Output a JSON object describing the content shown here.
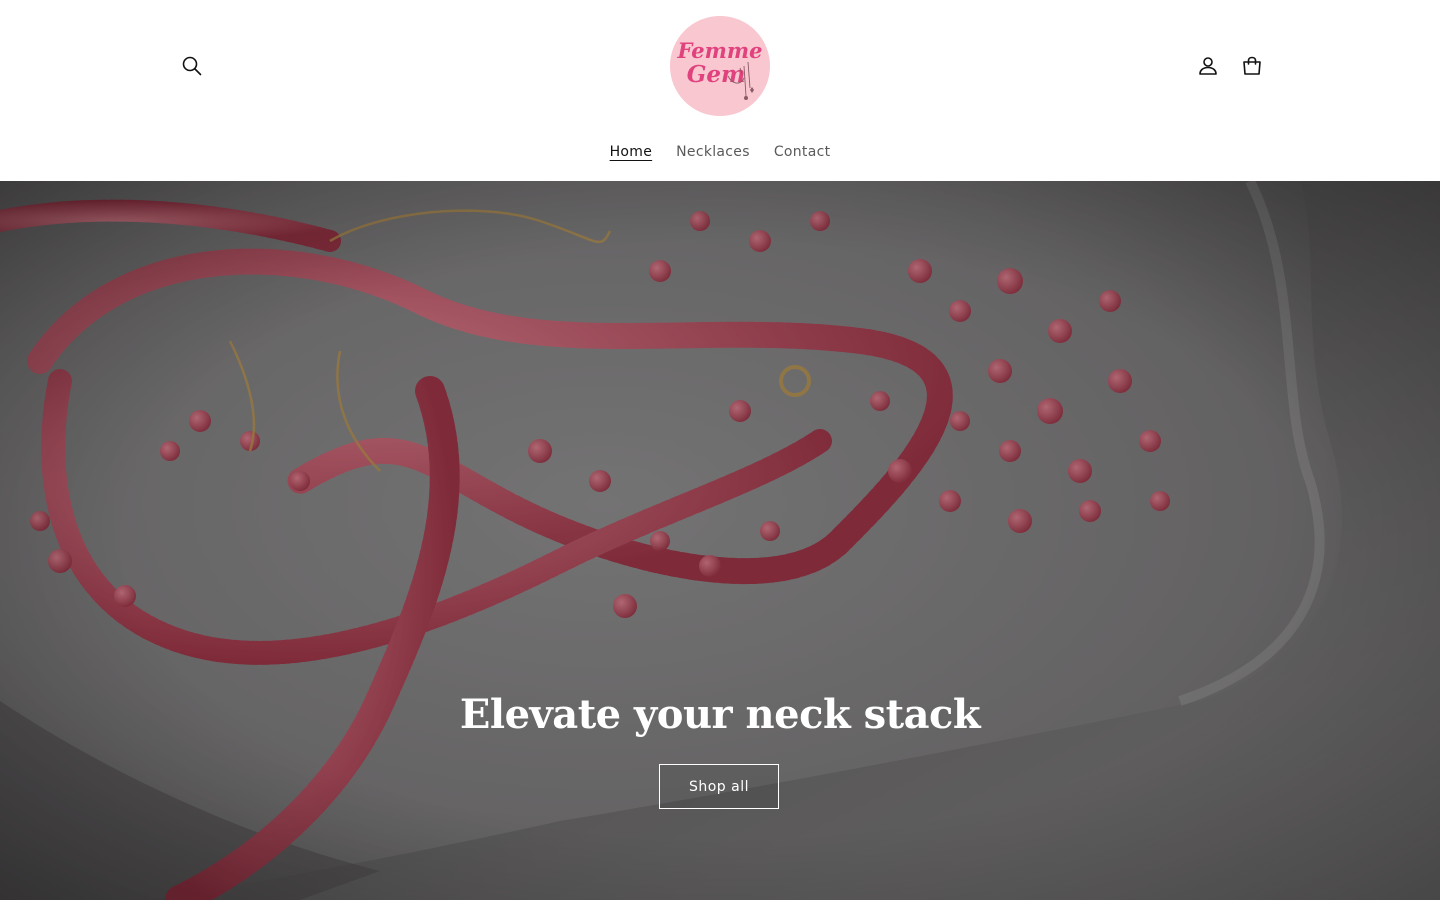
{
  "header": {
    "logo_text_line1": "Femme",
    "logo_text_line2": "Gem",
    "icons": {
      "search": "search-icon",
      "account": "account-icon",
      "cart": "cart-icon"
    }
  },
  "nav": {
    "items": [
      {
        "label": "Home",
        "active": true
      },
      {
        "label": "Necklaces",
        "active": false
      },
      {
        "label": "Contact",
        "active": false
      }
    ]
  },
  "hero": {
    "title": "Elevate your neck stack",
    "button_label": "Shop all"
  },
  "colors": {
    "logo_bg": "#f9c7cf",
    "logo_text": "#e0427e",
    "bead_pink": "#e2667a"
  }
}
